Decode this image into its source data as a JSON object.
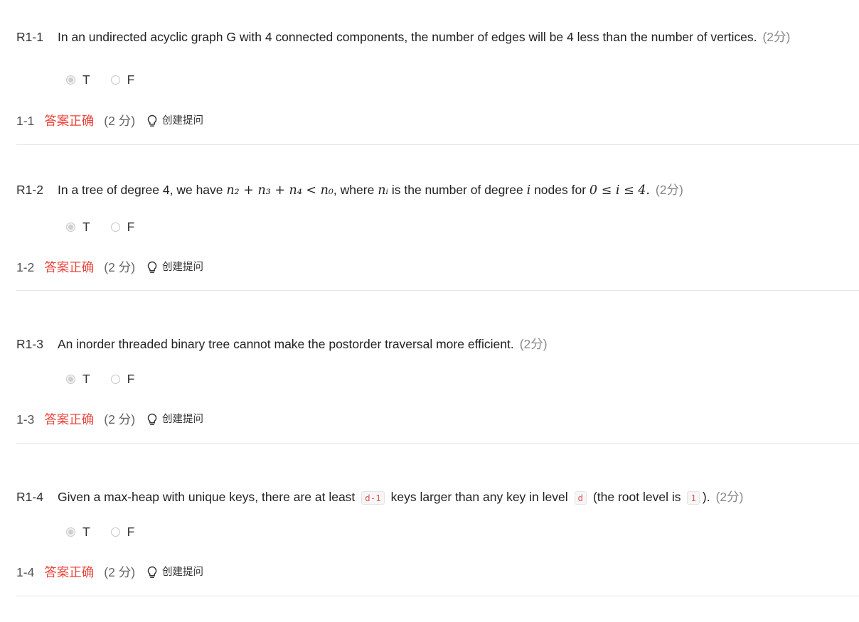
{
  "questions": [
    {
      "num": "R1-1",
      "text": "In an undirected acyclic graph G with 4 connected components, the number of edges will be 4 less than the number of vertices.",
      "score": "(2分)",
      "options": [
        {
          "label": "T",
          "selected": true
        },
        {
          "label": "F",
          "selected": false
        }
      ],
      "result": {
        "num": "1-1",
        "status": "答案正确",
        "score": "(2 分)",
        "hint": "创建提问"
      }
    },
    {
      "num": "R1-2",
      "text_before": "In a tree of degree 4, we have",
      "formula1": "n₂ + n₃ + n₄ < n₀",
      "text_mid1": ", where",
      "formula2": "nᵢ",
      "text_mid2": "is the number of degree",
      "formula3": "i",
      "text_mid3": "nodes for",
      "formula4": "0 ≤ i ≤ 4.",
      "score": "(2分)",
      "options": [
        {
          "label": "T",
          "selected": true
        },
        {
          "label": "F",
          "selected": false
        }
      ],
      "result": {
        "num": "1-2",
        "status": "答案正确",
        "score": "(2 分)",
        "hint": "创建提问"
      }
    },
    {
      "num": "R1-3",
      "text": "An inorder threaded binary tree cannot make the postorder traversal more efficient.",
      "score": "(2分)",
      "options": [
        {
          "label": "T",
          "selected": true
        },
        {
          "label": "F",
          "selected": false
        }
      ],
      "result": {
        "num": "1-3",
        "status": "答案正确",
        "score": "(2 分)",
        "hint": "创建提问"
      }
    },
    {
      "num": "R1-4",
      "text_a": "Given a max-heap with unique keys, there are at least",
      "code1": "d-1",
      "text_b": "keys larger than any key in level",
      "code2": "d",
      "text_c": "(the root level is",
      "code3": "1",
      "text_d": ").",
      "score": "(2分)",
      "options": [
        {
          "label": "T",
          "selected": true
        },
        {
          "label": "F",
          "selected": false
        }
      ],
      "result": {
        "num": "1-4",
        "status": "答案正确",
        "score": "(2 分)",
        "hint": "创建提问"
      }
    }
  ]
}
